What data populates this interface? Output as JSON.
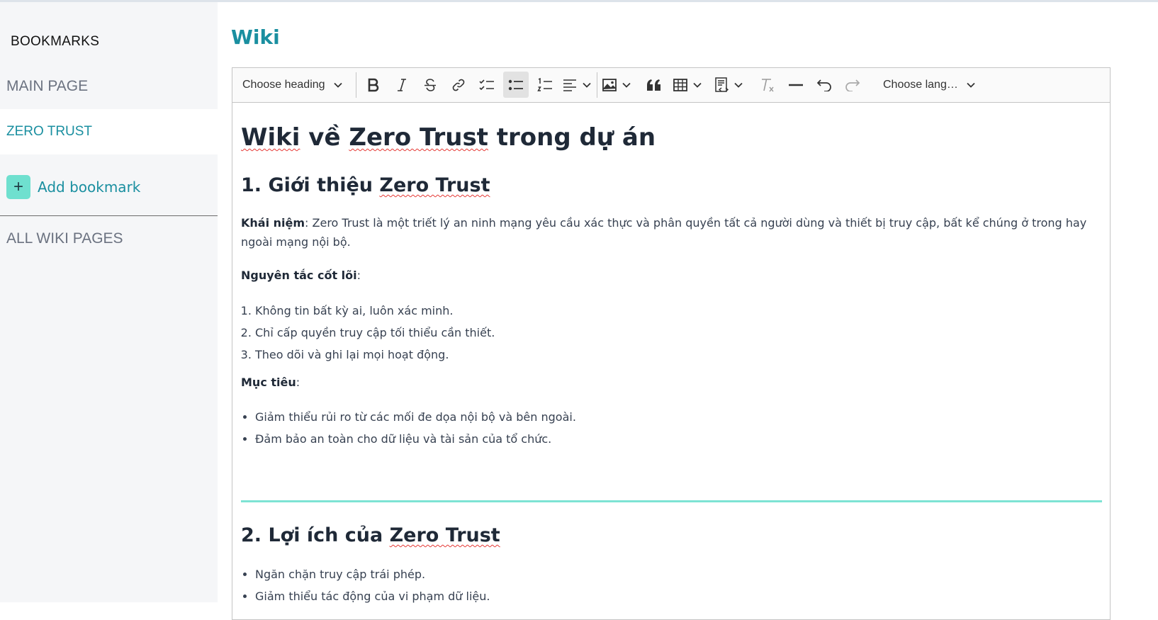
{
  "sidebar": {
    "title": "BOOKMARKS",
    "items": [
      {
        "label": "MAIN PAGE"
      },
      {
        "label": "ZERO TRUST"
      }
    ],
    "add_bookmark": "Add bookmark",
    "add_icon": "+",
    "all_pages": "ALL WIKI PAGES"
  },
  "page": {
    "title": "Wiki"
  },
  "toolbar": {
    "heading_select": "Choose heading",
    "language_select": "Choose lang…",
    "buttons": [
      "bold",
      "italic",
      "strikethrough",
      "link",
      "todo-list",
      "bulleted-list",
      "numbered-list",
      "alignment",
      "image",
      "block-quote",
      "table",
      "code-block",
      "remove-format",
      "horizontal-line",
      "undo",
      "redo"
    ],
    "active": "bulleted-list"
  },
  "doc": {
    "title": "Wiki về Zero Trust trong dự án",
    "s1_heading": "1. Giới thiệu Zero Trust",
    "concept_label": "Khái niệm",
    "concept_text": ": Zero Trust là một triết lý an ninh mạng yêu cầu xác thực và phân quyền tất cả người dùng và thiết bị truy cập, bất kể chúng ở trong hay ngoài mạng nội bộ.",
    "principles_label": "Nguyên tắc cốt lõi",
    "principles_colon": ":",
    "principles": [
      "Không tin bất kỳ ai, luôn xác minh.",
      "Chỉ cấp quyền truy cập tối thiểu cần thiết.",
      "Theo dõi và ghi lại mọi hoạt động."
    ],
    "goals_label": "Mục tiêu",
    "goals_colon": ":",
    "goals": [
      "Giảm thiểu rủi ro từ các mối đe dọa nội bộ và bên ngoài.",
      "Đảm bảo an toàn cho dữ liệu và tài sản của tổ chức."
    ],
    "s2_heading": "2. Lợi ích của Zero Trust",
    "benefits": [
      "Ngăn chặn truy cập trái phép.",
      "Giảm thiểu tác động của vi phạm dữ liệu."
    ]
  },
  "colors": {
    "accent": "#1a8fa0",
    "mint": "#6fe0cf",
    "divider": "#7ee3d4"
  }
}
